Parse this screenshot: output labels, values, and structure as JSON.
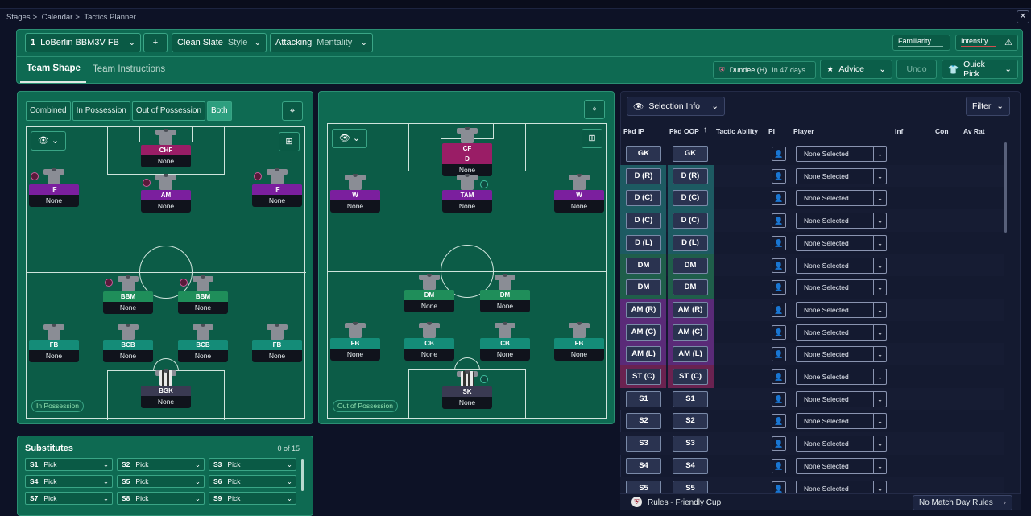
{
  "breadcrumb": [
    "Stages",
    "Calendar",
    "Tactics Planner"
  ],
  "tactic": {
    "slot": "1",
    "name": "LoBerlin BBM3V FB",
    "style_value": "Clean Slate",
    "style_label": "Style",
    "mentality_value": "Attacking",
    "mentality_label": "Mentality",
    "familiarity": "Familiarity",
    "intensity": "Intensity"
  },
  "tabs": {
    "team_shape": "Team Shape",
    "team_instructions": "Team Instructions"
  },
  "match": {
    "opponent": "Dundee (H)",
    "when": "In 47 days"
  },
  "actions": {
    "advice": "Advice",
    "undo": "Undo",
    "quick_pick": "Quick Pick",
    "add": "+"
  },
  "modes": [
    "Combined",
    "In Possession",
    "Out of Possession",
    "Both"
  ],
  "pitch_in": {
    "label": "In Possession",
    "players": [
      {
        "role": "CHF",
        "name": "None",
        "color": "magenta"
      },
      {
        "role": "IF",
        "name": "None",
        "color": "purple"
      },
      {
        "role": "AM",
        "name": "None",
        "color": "purple"
      },
      {
        "role": "IF",
        "name": "None",
        "color": "purple"
      },
      {
        "role": "BBM",
        "name": "None",
        "color": "green"
      },
      {
        "role": "BBM",
        "name": "None",
        "color": "green"
      },
      {
        "role": "FB",
        "name": "None",
        "color": "teal"
      },
      {
        "role": "BCB",
        "name": "None",
        "color": "teal"
      },
      {
        "role": "BCB",
        "name": "None",
        "color": "teal"
      },
      {
        "role": "FB",
        "name": "None",
        "color": "teal"
      },
      {
        "role": "BGK",
        "name": "None",
        "color": "gkc"
      }
    ]
  },
  "pitch_out": {
    "label": "Out of Possession",
    "players": [
      {
        "role": "CF",
        "role2": "D",
        "name": "None",
        "color": "magenta"
      },
      {
        "role": "W",
        "name": "None",
        "color": "purple"
      },
      {
        "role": "TAM",
        "name": "None",
        "color": "purple"
      },
      {
        "role": "W",
        "name": "None",
        "color": "purple"
      },
      {
        "role": "DM",
        "name": "None",
        "color": "green"
      },
      {
        "role": "DM",
        "name": "None",
        "color": "green"
      },
      {
        "role": "FB",
        "name": "None",
        "color": "teal"
      },
      {
        "role": "CB",
        "name": "None",
        "color": "teal"
      },
      {
        "role": "CB",
        "name": "None",
        "color": "teal"
      },
      {
        "role": "FB",
        "name": "None",
        "color": "teal"
      },
      {
        "role": "SK",
        "name": "None",
        "color": "gkc"
      }
    ]
  },
  "substitutes": {
    "title": "Substitutes",
    "count": "0 of 15",
    "slots": [
      {
        "id": "S1",
        "value": "Pick"
      },
      {
        "id": "S2",
        "value": "Pick"
      },
      {
        "id": "S3",
        "value": "Pick"
      },
      {
        "id": "S4",
        "value": "Pick"
      },
      {
        "id": "S5",
        "value": "Pick"
      },
      {
        "id": "S6",
        "value": "Pick"
      },
      {
        "id": "S7",
        "value": "Pick"
      },
      {
        "id": "S8",
        "value": "Pick"
      },
      {
        "id": "S9",
        "value": "Pick"
      }
    ]
  },
  "selection": {
    "info_label": "Selection Info",
    "filter_label": "Filter",
    "columns": [
      "Pkd IP",
      "Pkd OOP",
      "Tactic Ability",
      "PI",
      "Player",
      "Inf",
      "Con",
      "Av Rat"
    ],
    "rows": [
      {
        "ip": "GK",
        "oop": "GK",
        "player": "None Selected",
        "tint": "plain"
      },
      {
        "ip": "D (R)",
        "oop": "D (R)",
        "player": "None Selected",
        "tint": "teal"
      },
      {
        "ip": "D (C)",
        "oop": "D (C)",
        "player": "None Selected",
        "tint": "teal"
      },
      {
        "ip": "D (C)",
        "oop": "D (C)",
        "player": "None Selected",
        "tint": "teal"
      },
      {
        "ip": "D (L)",
        "oop": "D (L)",
        "player": "None Selected",
        "tint": "teal"
      },
      {
        "ip": "DM",
        "oop": "DM",
        "player": "None Selected",
        "tint": "green"
      },
      {
        "ip": "DM",
        "oop": "DM",
        "player": "None Selected",
        "tint": "green"
      },
      {
        "ip": "AM (R)",
        "oop": "AM (R)",
        "player": "None Selected",
        "tint": "purple"
      },
      {
        "ip": "AM (C)",
        "oop": "AM (C)",
        "player": "None Selected",
        "tint": "purple"
      },
      {
        "ip": "AM (L)",
        "oop": "AM (L)",
        "player": "None Selected",
        "tint": "purple"
      },
      {
        "ip": "ST (C)",
        "oop": "ST (C)",
        "player": "None Selected",
        "tint": "magenta"
      },
      {
        "ip": "S1",
        "oop": "S1",
        "player": "None Selected",
        "tint": "plain"
      },
      {
        "ip": "S2",
        "oop": "S2",
        "player": "None Selected",
        "tint": "plain"
      },
      {
        "ip": "S3",
        "oop": "S3",
        "player": "None Selected",
        "tint": "plain"
      },
      {
        "ip": "S4",
        "oop": "S4",
        "player": "None Selected",
        "tint": "plain"
      },
      {
        "ip": "S5",
        "oop": "S5",
        "player": "None Selected",
        "tint": "plain"
      }
    ]
  },
  "rules": {
    "label": "Rules - Friendly Cup",
    "right": "No Match Day Rules"
  },
  "tints": {
    "plain": "#2a3350",
    "teal": "#1d5a62",
    "green": "#1f5e4a",
    "purple": "#5a2a78",
    "magenta": "#6a2250"
  }
}
